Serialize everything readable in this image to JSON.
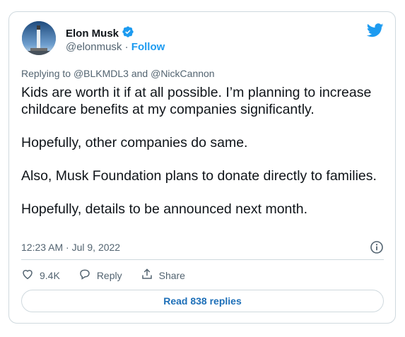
{
  "author": {
    "name": "Elon Musk",
    "handle": "@elonmusk",
    "separator": "·",
    "follow_label": "Follow"
  },
  "replying_to": {
    "prefix": "Replying to",
    "mention1": "@BLKMDL3",
    "conjunction": "and",
    "mention2": "@NickCannon"
  },
  "tweet": {
    "paragraphs": [
      "Kids are worth it if at all possible. I’m planning to increase childcare benefits at my companies significantly.",
      "Hopefully, other companies do same.",
      "Also, Musk Foundation plans to donate directly to families.",
      "Hopefully, details to be announced next month."
    ]
  },
  "meta": {
    "timestamp": "12:23 AM · Jul 9, 2022"
  },
  "actions": {
    "like_count": "9.4K",
    "reply_label": "Reply",
    "share_label": "Share"
  },
  "read_replies_label": "Read 838 replies",
  "colors": {
    "accent": "#1d9bf0",
    "text": "#0f1419",
    "muted": "#536471",
    "border": "#cfd9de"
  },
  "icons": [
    "verified-badge-icon",
    "twitter-bird-icon",
    "info-icon",
    "heart-icon",
    "reply-icon",
    "share-icon"
  ]
}
